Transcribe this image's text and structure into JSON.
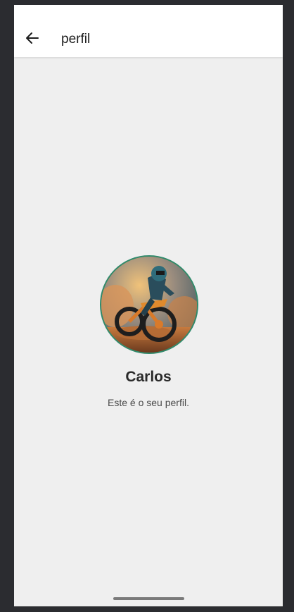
{
  "appbar": {
    "title": "perfil",
    "back_icon": "arrow-left-icon"
  },
  "profile": {
    "name": "Carlos",
    "subtitle": "Este é o seu perfil.",
    "avatar_image": "motocross-rider-photo",
    "avatar_border_color": "#2f8a6b"
  },
  "colors": {
    "background": "#efefef",
    "appbar": "#ffffff",
    "frame": "#2b2c30"
  }
}
